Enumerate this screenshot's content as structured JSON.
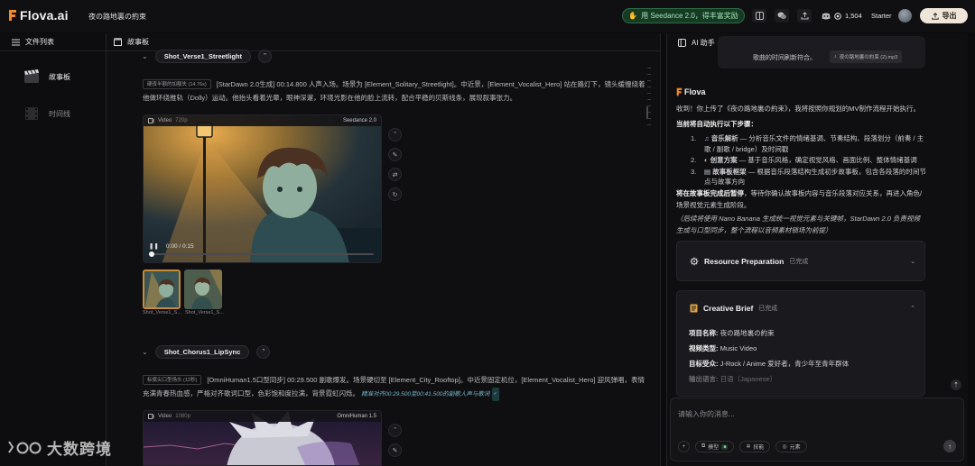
{
  "app": {
    "logo_text": "Flova.ai",
    "project_title": "夜の路地裏の約束",
    "promo_label": "用 Seedance 2.0，得丰富奖励",
    "credits": "1,504",
    "plan": "Starter",
    "export_label": "导出"
  },
  "left_panel": {
    "title": "文件列表",
    "items": [
      {
        "label": "故事板",
        "icon": "clapperboard-icon"
      },
      {
        "label": "时间线",
        "icon": "film-strip-icon"
      }
    ]
  },
  "storyboard": {
    "title": "故事板",
    "shots": [
      {
        "name": "Shot_Verse1_Streetlight",
        "tag": "硬夜半额的加额失 (14.76s)",
        "desc": "[StarDawn 2.0生成] 00:14.800 人声入场。场景为 [Element_Solitary_Streetlight]。中近景，[Element_Vocalist_Hero] 站在路灯下，镜头缓慢绕着他做环绕推轨（Dolly）运动。他抬头看着光晕，眼神深邃，环境光影在他的脸上流转，配合平稳的贝斯线条，展现叙事张力。",
        "player": {
          "type_label": "Video",
          "resolution": "720p",
          "model": "Seedance 2.0",
          "time": "0:00 / 0:15"
        },
        "thumbs": [
          "Shot_Verse1_S...",
          "Shot_Verse1_S..."
        ]
      },
      {
        "name": "Shot_Chorus1_LipSync",
        "tag": "标旗尖口型场头 (12秒)",
        "desc": "[OmniHuman1.5口型同步] 00:29.500 副歌爆发。场景硬切至 [Element_City_Rooftop]。中近景固定机位，[Element_Vocalist_Hero] 迎风弹唱，表情充满青春热血感，严格对齐歌词口型，色彩饱和度拉满，背景霓虹闪烁。",
        "highlight": "精准对齐00:29.500至00:41.500的副歌人声与歌词",
        "player": {
          "type_label": "Video",
          "resolution": "1080p",
          "model": "OmniHuman 1.5"
        }
      }
    ]
  },
  "assistant": {
    "title": "AI 助手",
    "file_msg": "歌曲的时间刷新符合。",
    "file_name": "夜の路地裏の約束 (2).mp3",
    "brand": "Flova",
    "intro": "收到！你上传了《夜の路地裏の約束》，我将按照你规划的MV制作流程开始执行。",
    "steps_heading": "当前将自动执行以下步骤：",
    "steps": [
      {
        "num": "1.",
        "icon": "music-note-icon",
        "title": "音乐解析",
        "text": " — 分析音乐文件的情绪基调、节奏结构、段落划分（前奏 / 主歌 / 副歌 / bridge）及时间戳"
      },
      {
        "num": "2.",
        "icon": "palette-icon",
        "title": "创意方案",
        "text": " — 基于音乐风格，确定视觉风格、画面比例、整体情绪基调"
      },
      {
        "num": "3.",
        "icon": "clipboard-icon",
        "title": "故事板框架",
        "text": " — 根据音乐段落结构生成初步故事板，包含各段落的时间节点与故事方向"
      }
    ],
    "pause_bold": "将在故事板完成后暂停",
    "pause_text": "，等待你确认故事板内容与音乐段落对应关系，再进入角色/场景视觉元素生成阶段。",
    "note": "（后续将使用 Nano Banana 生成统一视觉元素与关键帧，StarDawn 2.0 负责视频生成与口型同步，整个流程以音频素材锁场为前提）",
    "cards": [
      {
        "title": "Resource Preparation",
        "status": "已完成",
        "icon": "gear-icon"
      },
      {
        "title": "Creative Brief",
        "status": "已完成",
        "icon": "document-icon",
        "fields": [
          {
            "label": "项目名称:",
            "value": "夜の路地裏の約束"
          },
          {
            "label": "视频类型:",
            "value": "Music Video"
          },
          {
            "label": "目标受众:",
            "value": "J-Rock / Anime 爱好者，青少年至青年群体"
          },
          {
            "label": "输出语言:",
            "value": "日语（Japanese）"
          }
        ]
      }
    ],
    "input_placeholder": "请输入你的消息...",
    "chips": {
      "model": "模型",
      "model_badge": "■",
      "skill": "技能",
      "element": "元素"
    }
  },
  "watermark": "大数跨境",
  "colors": {
    "accent_promo": "#173a25",
    "export_bg": "#efe6da",
    "selected_thumb": "#c98a3a"
  }
}
